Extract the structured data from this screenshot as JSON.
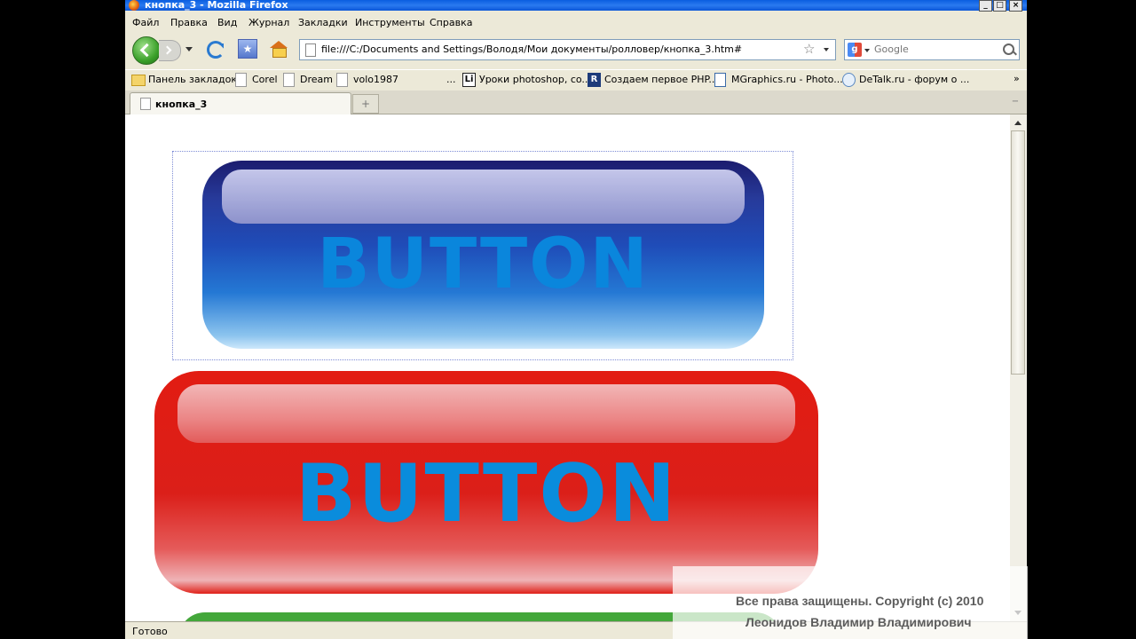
{
  "window": {
    "title": "кнопка_3 - Mozilla Firefox"
  },
  "menu": [
    "Файл",
    "Правка",
    "Вид",
    "Журнал",
    "Закладки",
    "Инструменты",
    "Справка"
  ],
  "nav": {
    "url": "file:///C:/Documents and Settings/Володя/Мои документы/ролловер/кнопка_3.htm#",
    "search_placeholder": "Google",
    "search_engine_icon": "google-icon"
  },
  "bookmarks": {
    "items": [
      {
        "label": "Панель закладок",
        "icon": "folder-icon"
      },
      {
        "label": "Corel",
        "icon": "page-icon"
      },
      {
        "label": "Dream",
        "icon": "page-icon"
      },
      {
        "label": "volo1987",
        "icon": "page-icon"
      },
      {
        "label": "...",
        "icon": ""
      },
      {
        "label": "Уроки photoshop, co...",
        "icon": "li-icon"
      },
      {
        "label": "Создаем первое PHP...",
        "icon": "r-icon"
      },
      {
        "label": "MGraphics.ru - Photo...",
        "icon": "mg-icon"
      },
      {
        "label": "DeTalk.ru - форум о ...",
        "icon": "detalk-icon"
      }
    ],
    "more": "»"
  },
  "tabs": [
    {
      "label": "кнопка_3",
      "active": true
    }
  ],
  "content": {
    "buttons": [
      {
        "label": "BUTTON",
        "color": "#1f4cb8",
        "text_color": "#0a86dc"
      },
      {
        "label": "BUTTON",
        "color": "#e21c12",
        "text_color": "#0a8cdc"
      },
      {
        "label": "",
        "color": "#43a73a"
      }
    ]
  },
  "status": {
    "text": "Готово"
  },
  "watermark": {
    "line1": "Все права защищены. Copyright (c) 2010",
    "line2": "Леонидов Владимир Владимирович"
  }
}
